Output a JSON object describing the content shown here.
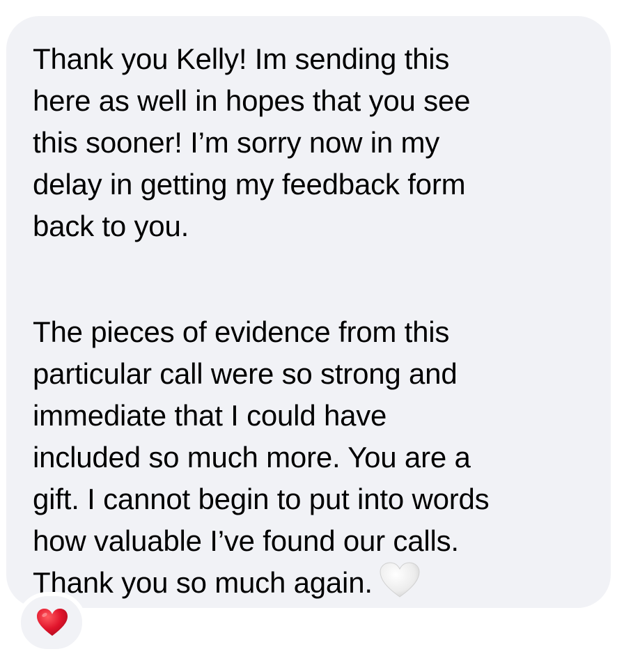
{
  "message": {
    "paragraph1_lines": [
      "Thank you Kelly! Im sending this",
      "here as well in hopes that you see",
      "this sooner! I’m sorry now in my",
      "delay in getting my feedback form",
      "back to you."
    ],
    "paragraph2_lines": [
      "The pieces of evidence from this",
      "particular call were so strong and",
      "immediate that I could have",
      "included so much more. You are a",
      "gift. I cannot begin to put into words",
      "how valuable I’ve found our calls.",
      "Thank you so much again."
    ],
    "inline_emoji": "white-heart-icon"
  },
  "reaction": {
    "emoji": "red-heart-icon",
    "color": "#e0142b"
  },
  "colors": {
    "bubble_background": "#f1f2f6",
    "text": "#000000",
    "white_heart": "#ececec"
  }
}
